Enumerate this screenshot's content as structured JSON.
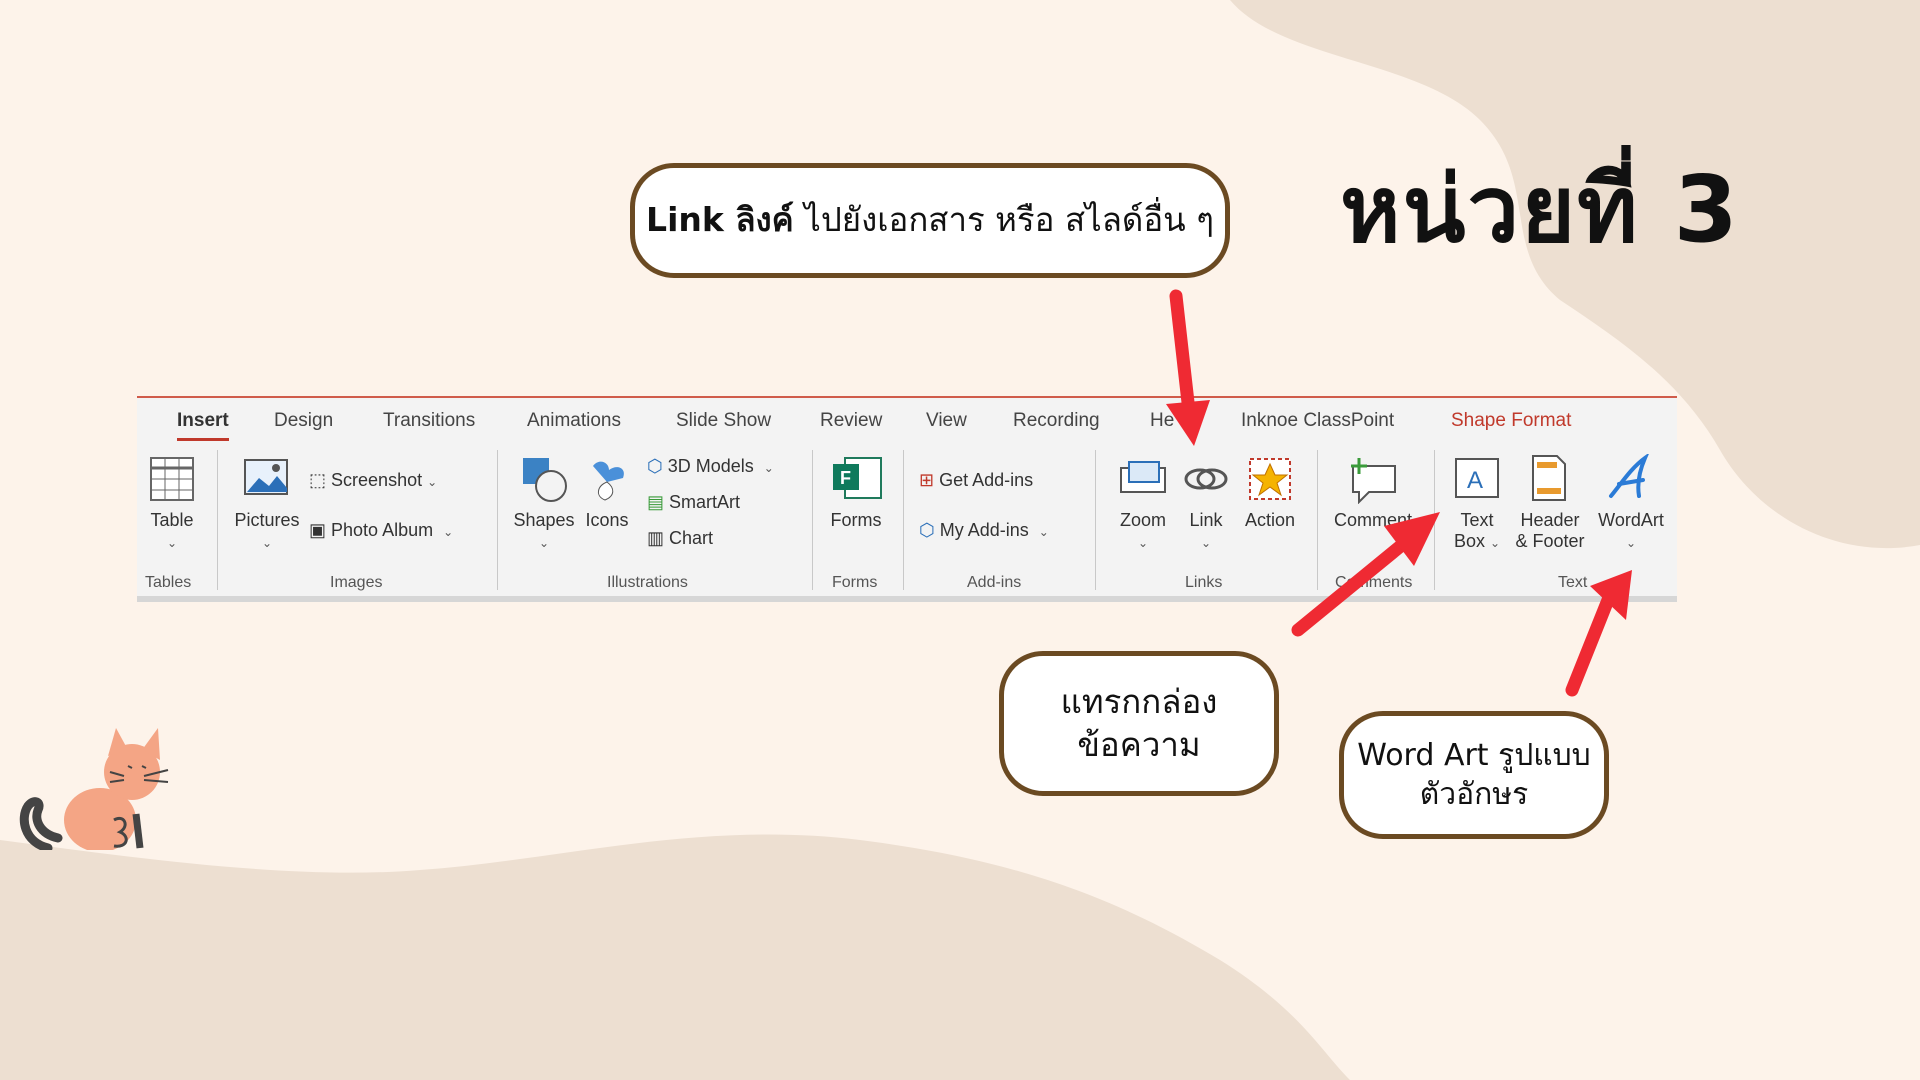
{
  "slide_title": "หน่วยที่ 3",
  "callouts": {
    "link_bold": "Link ลิงค์",
    "link_rest": " ไปยังเอกสาร หรือ สไลด์อื่น ๆ",
    "textbox_line1": "แทรกกล่อง",
    "textbox_line2": "ข้อความ",
    "wordart_line1": "Word Art รูปแบบ",
    "wordart_line2": "ตัวอักษร"
  },
  "ribbon": {
    "tabs": [
      "Insert",
      "Design",
      "Transitions",
      "Animations",
      "Slide Show",
      "Review",
      "View",
      "Recording",
      "He",
      "Inknoe ClassPoint",
      "Shape Format"
    ],
    "active_tab": "Insert",
    "commands": {
      "table": "Table",
      "pictures": "Pictures",
      "screenshot": "Screenshot",
      "photo_album": "Photo Album",
      "shapes": "Shapes",
      "icons": "Icons",
      "models_3d": "3D Models",
      "smartart": "SmartArt",
      "chart": "Chart",
      "forms": "Forms",
      "get_addins": "Get Add-ins",
      "my_addins": "My Add-ins",
      "zoom": "Zoom",
      "link": "Link",
      "action": "Action",
      "comment": "Comment",
      "text_box_1": "Text",
      "text_box_2": "Box",
      "header_footer_1": "Header",
      "header_footer_2": "& Footer",
      "wordart": "WordArt"
    },
    "groups": {
      "tables": "Tables",
      "images": "Images",
      "illustrations": "Illustrations",
      "forms": "Forms",
      "addins": "Add-ins",
      "links": "Links",
      "comments": "Comments",
      "text": "Text"
    }
  },
  "colors": {
    "background": "#fdf3ea",
    "blob": "#eddfd1",
    "arrow": "#ef2a33",
    "bubble_border": "#6b4a22",
    "accent_tab": "#c0392b"
  },
  "decor": {
    "cat_icon": "cat-icon",
    "arrows": [
      "arrow-to-link",
      "arrow-to-textbox",
      "arrow-to-wordart"
    ]
  }
}
